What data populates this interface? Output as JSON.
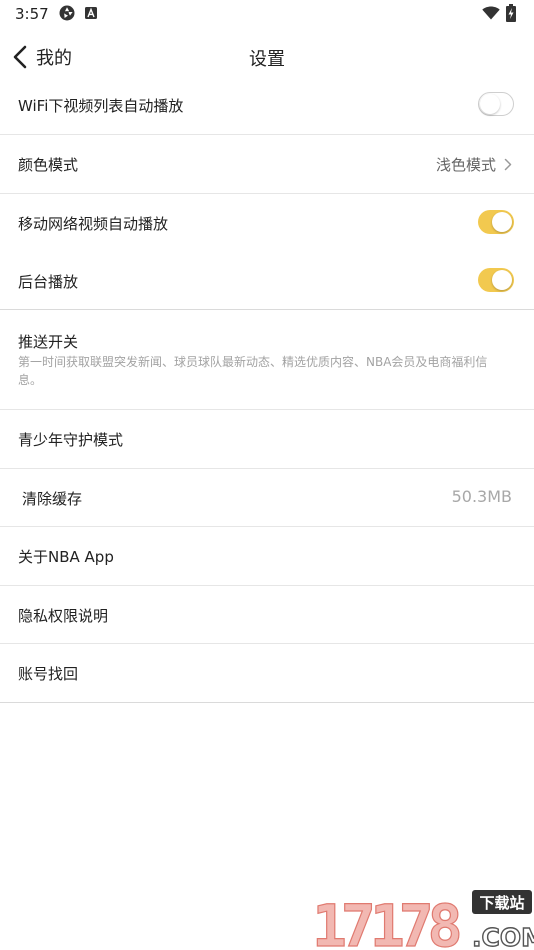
{
  "status_bar": {
    "time": "3:57",
    "aperture_icon": "aperture-icon",
    "notification_icon": "a-notification-icon",
    "wifi_icon": "wifi-icon",
    "battery_icon": "battery-charging-icon"
  },
  "header": {
    "back_label": "我的",
    "back_icon": "chevron-left-icon",
    "title": "设置"
  },
  "settings": {
    "wifi_autoplay": {
      "label": "WiFi下视频列表自动播放",
      "enabled": false
    },
    "color_mode": {
      "label": "颜色模式",
      "value": "浅色模式",
      "icon": "chevron-right-icon"
    },
    "mobile_autoplay": {
      "label": "移动网络视频自动播放",
      "enabled": true
    },
    "background_play": {
      "label": "后台播放",
      "enabled": true
    },
    "push": {
      "label": "推送开关",
      "description": "第一时间获取联盟突发新闻、球员球队最新动态、精选优质内容、NBA会员及电商福利信息。"
    },
    "youth_mode": {
      "label": "青少年守护模式"
    },
    "clear_cache": {
      "label": "清除缓存",
      "value": "50.3MB"
    },
    "about": {
      "label": "关于NBA App"
    },
    "privacy": {
      "label": "隐私权限说明"
    },
    "account_recovery": {
      "label": "账号找回"
    }
  },
  "watermark": {
    "number": "17178",
    "badge": "下载站",
    "domain": ".COM"
  },
  "colors": {
    "toggle_on": "#f2c94f",
    "toggle_off_border": "#cfcfcf",
    "divider": "#e6e6e6",
    "description": "#a3a3a3"
  }
}
